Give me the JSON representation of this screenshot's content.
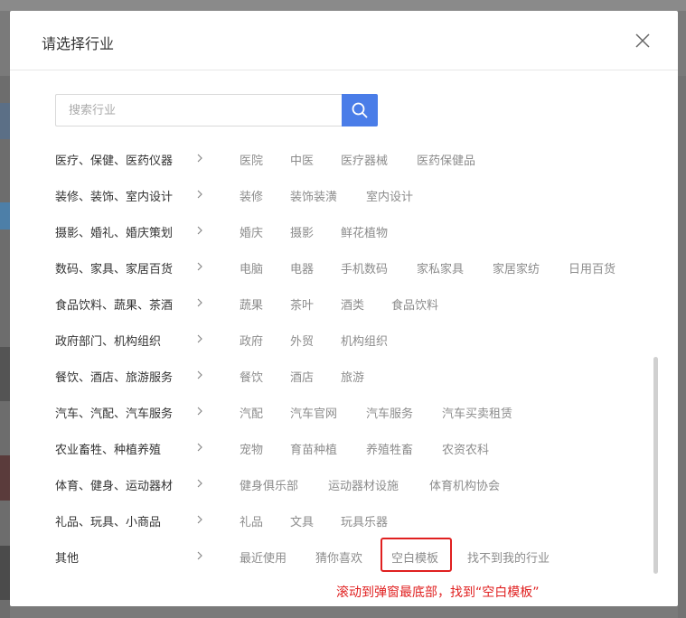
{
  "modal": {
    "title": "请选择行业"
  },
  "search": {
    "placeholder": "搜索行业"
  },
  "categories": [
    {
      "label": "医疗、保健、医药仪器",
      "subs": [
        "医院",
        "中医",
        "医疗器械",
        "医药保健品"
      ]
    },
    {
      "label": "装修、装饰、室内设计",
      "subs": [
        "装修",
        "装饰装潢",
        "室内设计"
      ]
    },
    {
      "label": "摄影、婚礼、婚庆策划",
      "subs": [
        "婚庆",
        "摄影",
        "鲜花植物"
      ]
    },
    {
      "label": "数码、家具、家居百货",
      "subs": [
        "电脑",
        "电器",
        "手机数码",
        "家私家具",
        "家居家纺",
        "日用百货"
      ]
    },
    {
      "label": "食品饮料、蔬果、茶酒",
      "subs": [
        "蔬果",
        "茶叶",
        "酒类",
        "食品饮料"
      ]
    },
    {
      "label": "政府部门、机构组织",
      "subs": [
        "政府",
        "外贸",
        "机构组织"
      ]
    },
    {
      "label": "餐饮、酒店、旅游服务",
      "subs": [
        "餐饮",
        "酒店",
        "旅游"
      ]
    },
    {
      "label": "汽车、汽配、汽车服务",
      "subs": [
        "汽配",
        "汽车官网",
        "汽车服务",
        "汽车买卖租赁"
      ]
    },
    {
      "label": "农业畜牲、种植养殖",
      "subs": [
        "宠物",
        "育苗种植",
        "养殖牲畜",
        "农资农科"
      ]
    },
    {
      "label": "体育、健身、运动器材",
      "subs": [
        "健身俱乐部",
        "运动器材设施",
        "体育机构协会"
      ]
    },
    {
      "label": "礼品、玩具、小商品",
      "subs": [
        "礼品",
        "文具",
        "玩具乐器"
      ]
    },
    {
      "label": "其他",
      "subs": [
        "最近使用",
        "猜你喜欢",
        "空白模板",
        "找不到我的行业"
      ]
    }
  ],
  "annotation": {
    "text": "滚动到弹窗最底部，找到“空白模板”",
    "highlight_color": "#e02020"
  },
  "colors": {
    "accent": "#4a7de8",
    "label": "#333333",
    "sub_item": "#8c8c8c"
  },
  "icons": {
    "search": "search-icon",
    "close": "close-icon",
    "chevron": "chevron-right-icon"
  }
}
